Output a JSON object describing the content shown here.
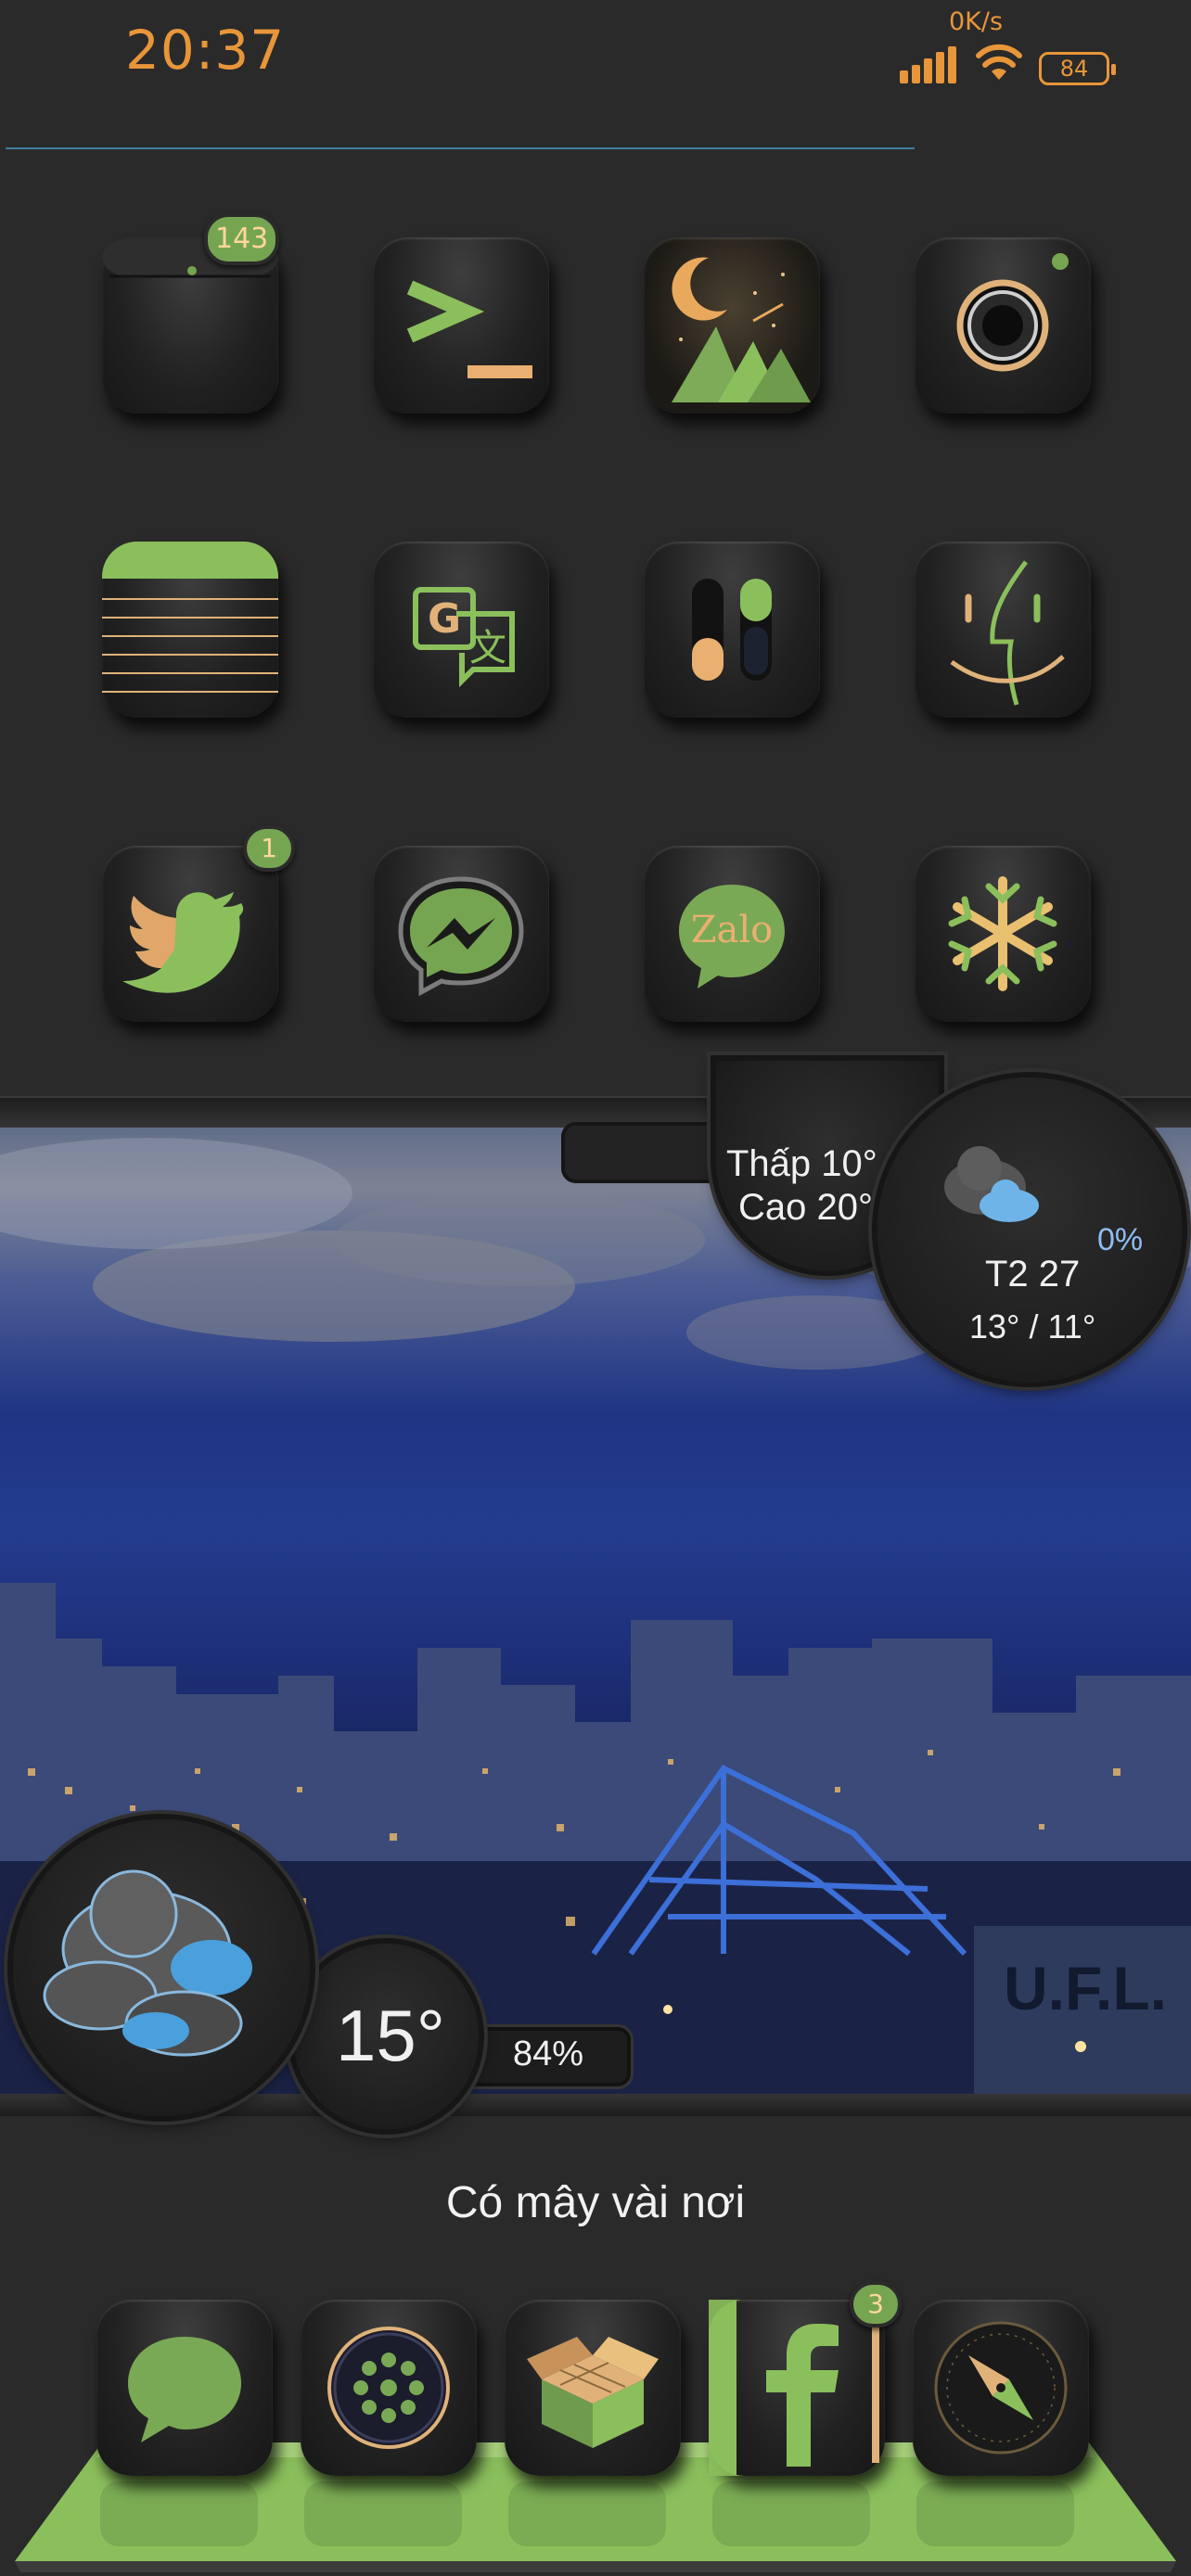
{
  "status_bar": {
    "time": "20:37",
    "net_speed": "0K/s",
    "battery_level": "84",
    "signal_icon": "cellular-signal-icon",
    "wifi_icon": "wifi-icon",
    "accent_color": "#e8963a"
  },
  "home_grid": {
    "rows": [
      [
        {
          "name": "app-badge-tray",
          "icon": "tray-icon",
          "badge": "143"
        },
        {
          "name": "terminal",
          "icon": "terminal-icon",
          "badge": ""
        },
        {
          "name": "wallpaper-night",
          "icon": "moon-mountains-icon",
          "badge": ""
        },
        {
          "name": "camera",
          "icon": "camera-icon",
          "badge": ""
        }
      ],
      [
        {
          "name": "notes",
          "icon": "notes-lines-icon",
          "badge": ""
        },
        {
          "name": "google-translate",
          "icon": "translate-icon",
          "badge": ""
        },
        {
          "name": "settings-toggles",
          "icon": "toggles-icon",
          "badge": ""
        },
        {
          "name": "finder",
          "icon": "finder-face-icon",
          "badge": ""
        }
      ],
      [
        {
          "name": "twitter",
          "icon": "twitter-bird-icon",
          "badge": "1"
        },
        {
          "name": "messenger",
          "icon": "messenger-icon",
          "badge": ""
        },
        {
          "name": "zalo",
          "icon": "zalo-icon",
          "badge": "",
          "label": "Zalo"
        },
        {
          "name": "snowflake",
          "icon": "snowflake-icon",
          "badge": ""
        }
      ]
    ]
  },
  "weather_widget": {
    "low_temp": "Thấp 10°",
    "high_temp": "Cao 20°",
    "forecast": {
      "precip": "0%",
      "day": "T2 27",
      "range": "13° / 11°",
      "icon": "cloudy-icon"
    },
    "current": {
      "temp": "15°",
      "humidity": "84%",
      "icon": "clouds-icon"
    },
    "condition": "Có mây vài nơi",
    "store_sign": "U.F.L."
  },
  "dock": {
    "apps": [
      {
        "name": "messages",
        "icon": "speech-bubble-icon",
        "badge": ""
      },
      {
        "name": "launcher",
        "icon": "app-dots-icon",
        "badge": ""
      },
      {
        "name": "cydia",
        "icon": "open-box-icon",
        "badge": ""
      },
      {
        "name": "facebook",
        "icon": "facebook-f-icon",
        "badge": "3"
      },
      {
        "name": "safari",
        "icon": "compass-icon",
        "badge": ""
      }
    ]
  },
  "colors": {
    "green": "#76a552",
    "orange": "#e8963a",
    "background": "#2a2a2a",
    "weather_blue": "#8fbdf0"
  }
}
